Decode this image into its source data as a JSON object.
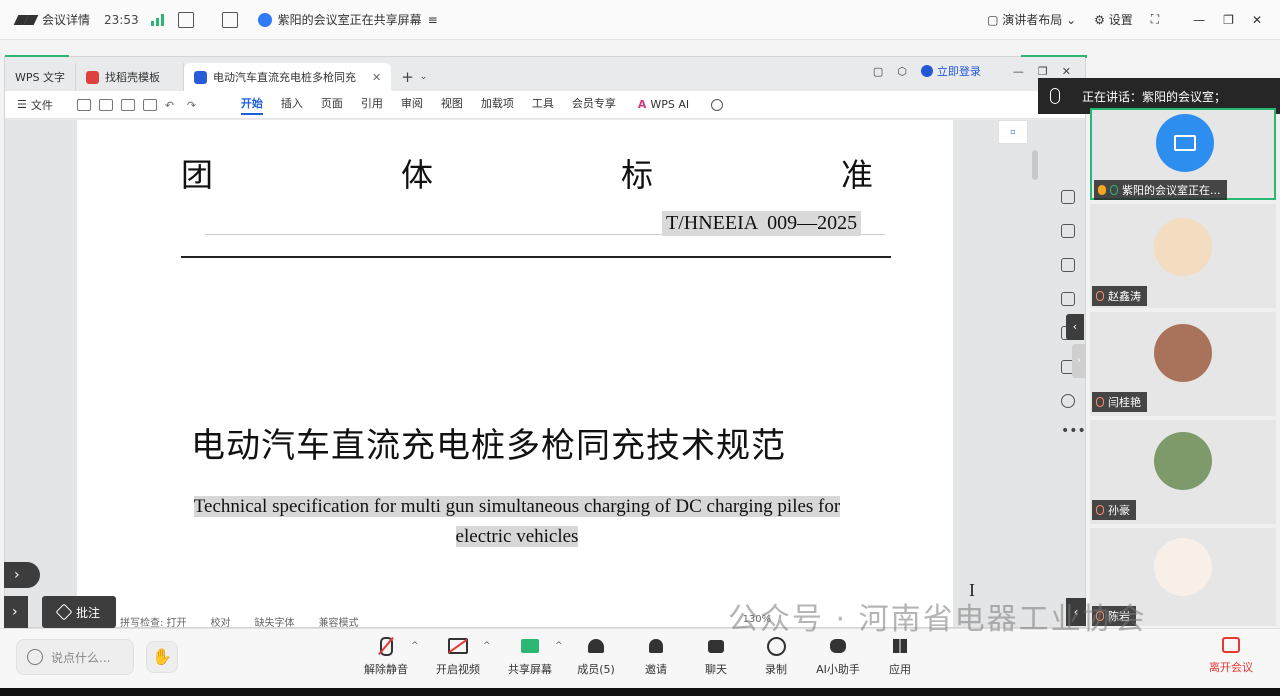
{
  "meeting_top": {
    "details": "会议详情",
    "time": "23:53",
    "sharing_text": "紫阳的会议室正在共享屏幕",
    "layout_label": "演讲者布局",
    "settings_label": "设置"
  },
  "wps": {
    "tabs": [
      {
        "label": "WPS 文字"
      },
      {
        "label": "找稻壳模板"
      },
      {
        "label": "电动汽车直流充电桩多枪同充"
      }
    ],
    "login_label": "立即登录",
    "file_label": "文件",
    "ribbon_menu": [
      "开始",
      "插入",
      "页面",
      "引用",
      "审阅",
      "视图",
      "加载项",
      "工具",
      "会员专享"
    ],
    "wps_ai_label": "WPS AI",
    "annot_label": "批注",
    "status_items": [
      "拼写检查: 打开",
      "校对",
      "缺失字体",
      "兼容模式",
      "130%"
    ]
  },
  "document": {
    "header_chars": [
      "团",
      "体",
      "标",
      "准"
    ],
    "std_code": "T/HNEEIA  009—2025",
    "title_cn": "电动汽车直流充电桩多枪同充技术规范",
    "title_en_line1": "Technical specification for multi gun simultaneous charging of DC charging piles for",
    "title_en_line2": "electric vehicles"
  },
  "panel": {
    "speaking_label": "正在讲话：紫阳的会议室；",
    "participants": [
      {
        "name": "紫阳的会议室正在..."
      },
      {
        "name": "赵鑫涛"
      },
      {
        "name": "闫桂艳"
      },
      {
        "name": "孙豪"
      },
      {
        "name": "陈岩"
      }
    ]
  },
  "bottom": {
    "say_placeholder": "说点什么...",
    "unmute": "解除静音",
    "start_video": "开启视频",
    "share_screen": "共享屏幕",
    "members": "成员(5)",
    "invite": "邀请",
    "chat": "聊天",
    "record": "录制",
    "ai_assistant": "AI小助手",
    "apps": "应用",
    "leave": "离开会议",
    "watermark": "公众号 · 河南省电器工业协会"
  },
  "colors": {
    "accent_green": "#2bb673",
    "wps_blue": "#1f5fdc",
    "danger": "#e53935"
  }
}
